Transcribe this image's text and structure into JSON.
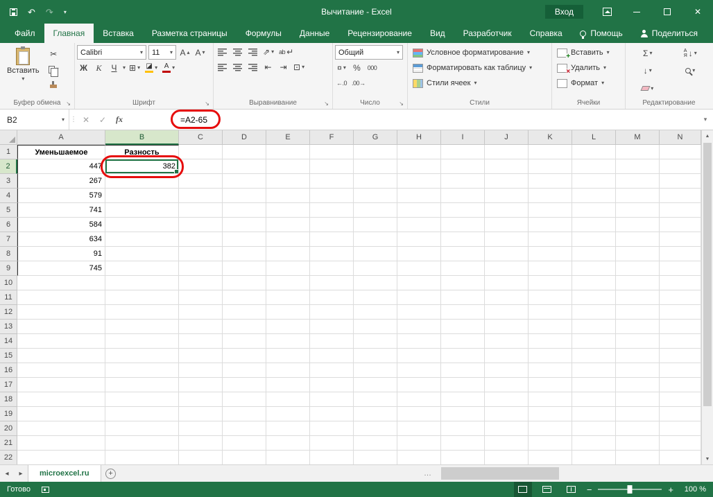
{
  "colors": {
    "excel_green": "#217346",
    "table_header_fill": "#5fba46",
    "annotation_red": "#e60d0d",
    "selected_header_fill": "#d7e7cb"
  },
  "title_bar": {
    "title": "Вычитание - Excel",
    "sign_in_label": "Вход"
  },
  "ribbon_tabs": {
    "items": [
      {
        "label": "Файл",
        "name": "file",
        "active": false
      },
      {
        "label": "Главная",
        "name": "home",
        "active": true
      },
      {
        "label": "Вставка",
        "name": "insert",
        "active": false
      },
      {
        "label": "Разметка страницы",
        "name": "page-layout",
        "active": false
      },
      {
        "label": "Формулы",
        "name": "formulas",
        "active": false
      },
      {
        "label": "Данные",
        "name": "data",
        "active": false
      },
      {
        "label": "Рецензирование",
        "name": "review",
        "active": false
      },
      {
        "label": "Вид",
        "name": "view",
        "active": false
      },
      {
        "label": "Разработчик",
        "name": "developer",
        "active": false
      },
      {
        "label": "Справка",
        "name": "help",
        "active": false
      }
    ],
    "help_label": "Помощь",
    "share_label": "Поделиться"
  },
  "ribbon": {
    "clipboard": {
      "group_label": "Буфер обмена",
      "paste_label": "Вставить"
    },
    "font": {
      "group_label": "Шрифт",
      "font_name": "Calibri",
      "font_size": "11",
      "bold": "Ж",
      "italic": "К",
      "underline": "Ч"
    },
    "alignment": {
      "group_label": "Выравнивание",
      "wrap_label": "ab"
    },
    "number": {
      "group_label": "Число",
      "format_value": "Общий",
      "percent": "%",
      "thousands": "000"
    },
    "styles": {
      "group_label": "Стили",
      "conditional_label": "Условное форматирование",
      "format_table_label": "Форматировать как таблицу",
      "cell_styles_label": "Стили ячеек"
    },
    "cells": {
      "group_label": "Ячейки",
      "insert_label": "Вставить",
      "delete_label": "Удалить",
      "format_label": "Формат"
    },
    "editing": {
      "group_label": "Редактирование"
    }
  },
  "formula_bar": {
    "name_box": "B2",
    "fx_label": "fx",
    "formula": "=A2-65"
  },
  "grid": {
    "column_letters": [
      "A",
      "B",
      "C",
      "D",
      "E",
      "F",
      "G",
      "H",
      "I",
      "J",
      "K",
      "L",
      "M",
      "N"
    ],
    "row_numbers": [
      "1",
      "2",
      "3",
      "4",
      "5",
      "6",
      "7",
      "8",
      "9",
      "10",
      "11",
      "12",
      "13",
      "14",
      "15",
      "16",
      "17",
      "18",
      "19",
      "20",
      "21",
      "22"
    ],
    "selected_column": "B",
    "selected_row": "2",
    "selected_cell": "B2",
    "cells": {
      "A1": "Уменьшаемое",
      "B1": "Разность",
      "A2": "447",
      "B2": "382",
      "A3": "267",
      "A4": "579",
      "A5": "741",
      "A6": "584",
      "A7": "634",
      "A8": "91",
      "A9": "745"
    }
  },
  "sheet_bar": {
    "sheet_tab": "microexcel.ru"
  },
  "status_bar": {
    "status": "Готово",
    "zoom": "100 %"
  },
  "glyphs": {
    "caret_down": "▾",
    "caret_up": "▴",
    "undo": "↶",
    "redo": "↷",
    "close": "✕",
    "check": "✓",
    "cut": "✂",
    "letter_a": "А",
    "borders": "⊞",
    "bucket": "◪",
    "orientation": "⇗",
    "return": "↵",
    "indent_left": "⇤",
    "indent_right": "⇥",
    "merge": "⊡",
    "currency": "¤",
    "inc_decimal": "←.0",
    "dec_decimal": ".00→",
    "sum": "Σ",
    "fill_down": "↓",
    "sort_top": "А",
    "sort_bottom": "Я",
    "launcher": "↘",
    "grip": "⋮",
    "ellipsis": "…",
    "nav_left": "◂",
    "nav_right": "▸",
    "scroll_up": "▲",
    "scroll_down": "▼",
    "plus": "+",
    "times": "×",
    "minus": "−"
  }
}
